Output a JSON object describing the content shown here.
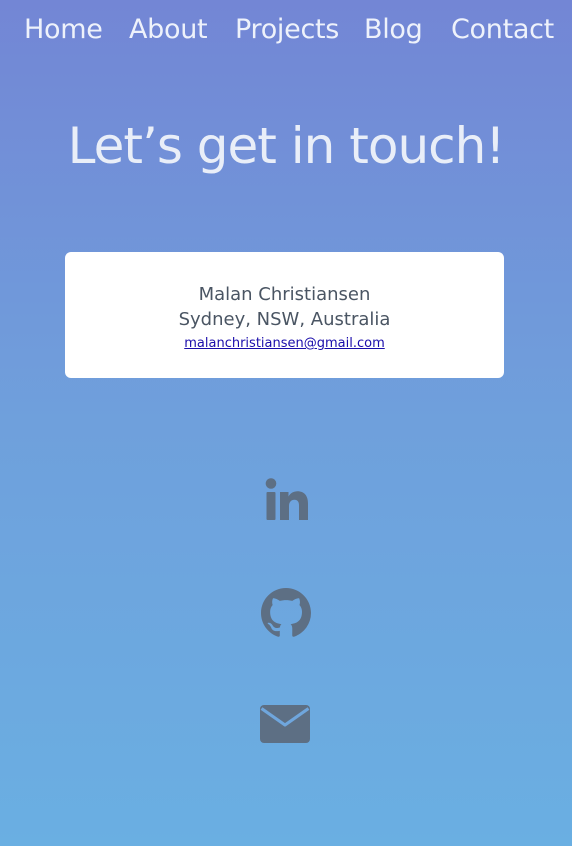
{
  "nav": {
    "items": [
      {
        "label": "Home"
      },
      {
        "label": "About"
      },
      {
        "label": "Projects"
      },
      {
        "label": "Blog"
      },
      {
        "label": "Contact"
      }
    ]
  },
  "contact": {
    "heading": "Let’s get in touch!",
    "name": "Malan Christiansen",
    "location": "Sydney, NSW, Australia",
    "email": "malanchristiansen@gmail.com"
  },
  "social": {
    "icons": [
      "linkedin-icon",
      "github-icon",
      "mail-icon"
    ],
    "icon_color": "#5d6f84"
  },
  "colors": {
    "gradient_top": "#7386d5",
    "gradient_bottom": "#6aafe2",
    "card_background": "#ffffff",
    "link": "#1a0dab"
  }
}
